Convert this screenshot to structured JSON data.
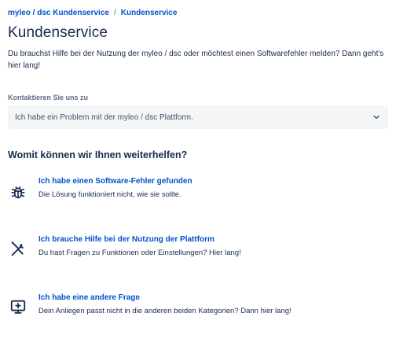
{
  "breadcrumb": {
    "items": [
      "myleo / dsc Kundenservice",
      "Kundenservice"
    ],
    "separator": "/"
  },
  "header": {
    "title": "Kundenservice",
    "intro": "Du brauchst Hilfe bei der Nutzung der myleo / dsc oder möchtest einen Softwarefehler melden? Dann geht's hier lang!"
  },
  "contact": {
    "label": "Kontaktieren Sie uns zu",
    "selected": "Ich habe ein Problem mit der myleo / dsc Plattform.",
    "chevron_icon": "chevron-down-icon"
  },
  "help": {
    "heading": "Womit können wir Ihnen weiterhelfen?",
    "options": [
      {
        "icon": "bug-icon",
        "title": "Ich habe einen Software-Fehler gefunden",
        "description": "Die Lösung funktioniert nicht, wie sie sollte."
      },
      {
        "icon": "tools-icon",
        "title": "Ich brauche Hilfe bei der Nutzung der Plattform",
        "description": "Du hast Fragen zu Funktionen oder Einstellungen? Hier lang!"
      },
      {
        "icon": "monitor-plus-icon",
        "title": "Ich habe eine andere Frage",
        "description": "Dein Anliegen passt nicht in die anderen beiden Kategorien? Dann hier lang!"
      }
    ]
  },
  "colors": {
    "link": "#0052cc",
    "text": "#172b4d",
    "muted": "#5e6c84",
    "select_bg": "#f4f5f7"
  }
}
